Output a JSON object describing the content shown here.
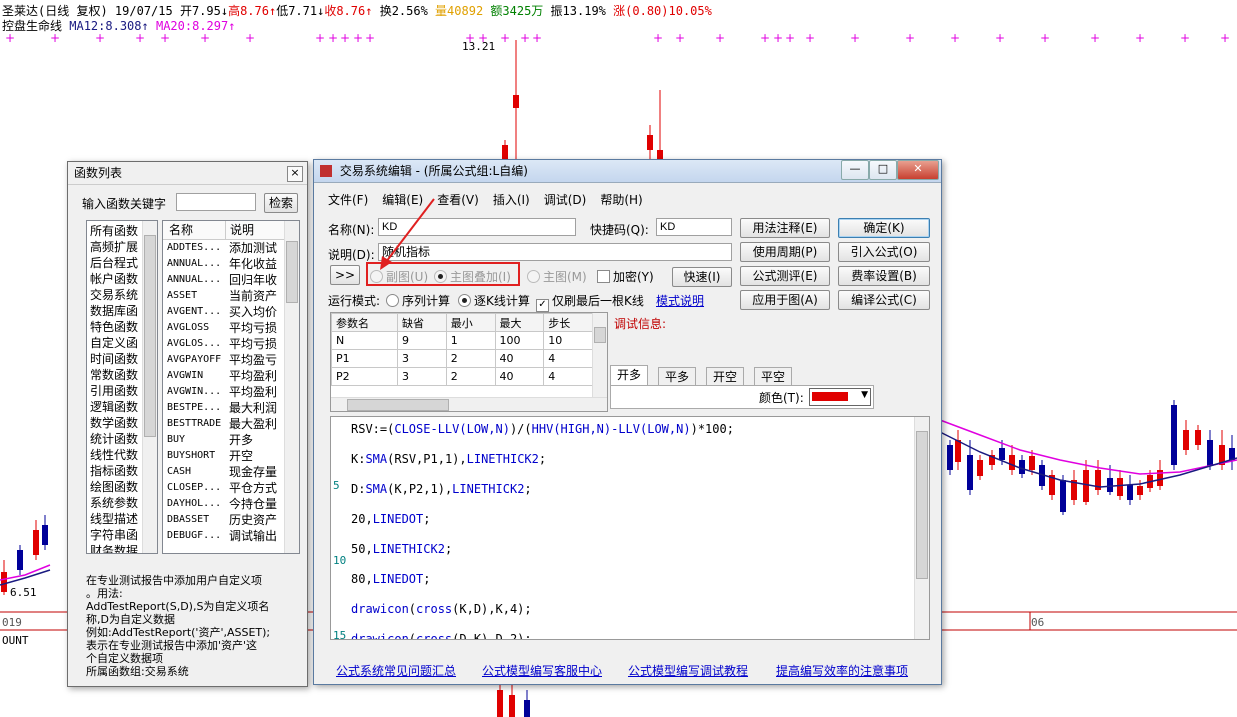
{
  "chart_header": {
    "stock": "圣莱达(日线 复权)",
    "date": "19/07/15",
    "open": "开7.95↓",
    "high": "高8.76↑",
    "low": "低7.71↓",
    "close": "收8.76↑",
    "turnover": "换2.56%",
    "volume": "量40892",
    "amount": "额3425万",
    "amplitude": "振13.19%",
    "change": "涨(0.80)10.05%"
  },
  "indicator_line": {
    "name": "控盘生命线",
    "ma12": "MA12:8.308↑",
    "ma20": "MA20:8.297↑"
  },
  "chart_labels": {
    "high_price": "13.21",
    "low_price": "6.51",
    "x_year": "019",
    "x_month": "06",
    "bottom_left": "OUNT"
  },
  "colors": {
    "up": "#e00000",
    "down": "#000099",
    "ma12": "#1a1a80",
    "ma20": "#e000e0",
    "marker": "#e000e0",
    "hilite": "#e02020"
  },
  "func_window": {
    "title": "函数列表",
    "close": "×",
    "search_label": "输入函数关键字",
    "search_value": "",
    "search_button": "检索",
    "categories": [
      "所有函数",
      "高频扩展",
      "后台程式",
      "帐户函数",
      "交易系统",
      "数据库函",
      "特色函数",
      "自定义函",
      "时间函数",
      "常数函数",
      "引用函数",
      "逻辑函数",
      "数学函数",
      "统计函数",
      "线性代数",
      "指标函数",
      "绘图函数",
      "系统参数",
      "线型描述",
      "字符串函",
      "财务数据"
    ],
    "col_name": "名称",
    "col_desc": "说明",
    "functions": [
      {
        "name": "ADDTES...",
        "desc": "添加测试"
      },
      {
        "name": "ANNUAL...",
        "desc": "年化收益"
      },
      {
        "name": "ANNUAL...",
        "desc": "回归年收"
      },
      {
        "name": "ASSET",
        "desc": "当前资产"
      },
      {
        "name": "AVGENT...",
        "desc": "买入均价"
      },
      {
        "name": "AVGLOSS",
        "desc": "平均亏损"
      },
      {
        "name": "AVGLOS...",
        "desc": "平均亏损"
      },
      {
        "name": "AVGPAYOFF",
        "desc": "平均盈亏"
      },
      {
        "name": "AVGWIN",
        "desc": "平均盈利"
      },
      {
        "name": "AVGWIN...",
        "desc": "平均盈利"
      },
      {
        "name": "BESTPE...",
        "desc": "最大利润"
      },
      {
        "name": "BESTTRADE",
        "desc": "最大盈利"
      },
      {
        "name": "BUY",
        "desc": "开多"
      },
      {
        "name": "BUYSHORT",
        "desc": "开空"
      },
      {
        "name": "CASH",
        "desc": "现金存量"
      },
      {
        "name": "CLOSEP...",
        "desc": "平仓方式"
      },
      {
        "name": "DAYHOL...",
        "desc": "今持仓量"
      },
      {
        "name": "DBASSET",
        "desc": "历史资产"
      },
      {
        "name": "DEBUGF...",
        "desc": "调试输出"
      }
    ],
    "help_lines": [
      "在专业测试报告中添加用户自定义项",
      "。用法:",
      "AddTestReport(S,D),S为自定义项名",
      "称,D为自定义数据",
      "例如:AddTestReport('资产',ASSET);",
      "表示在专业测试报告中添加'资产'这",
      "个自定义数据项",
      "所属函数组:交易系统"
    ]
  },
  "editor_window": {
    "title": "交易系统编辑 - (所属公式组:L自编)",
    "menu": [
      "文件(F)",
      "编辑(E)",
      "查看(V)",
      "插入(I)",
      "调试(D)",
      "帮助(H)"
    ],
    "name_label": "名称(N):",
    "name_value": "KD",
    "shortcut_label": "快捷码(Q):",
    "shortcut_value": "KD",
    "desc_label": "说明(D):",
    "desc_value": "随机指标",
    "expand_button": ">>",
    "radio_sub": "副图(U)",
    "radio_main_overlay": "主图叠加(I)",
    "radio_main": "主图(M)",
    "encrypt": "加密(Y)",
    "quick_button": "快速(I)",
    "run_mode_label": "运行模式:",
    "mode_sequence": "序列计算",
    "mode_bar": "逐K线计算",
    "only_last": "仅刷最后一根K线",
    "mode_help": "模式说明",
    "buttons_mid": [
      "用法注释(E)",
      "使用周期(P)",
      "公式测评(E)",
      "应用于图(A)"
    ],
    "buttons_right": [
      "确定(K)",
      "引入公式(O)",
      "费率设置(B)",
      "编译公式(C)"
    ],
    "param_headers": [
      "参数名",
      "缺省",
      "最小",
      "最大",
      "步长"
    ],
    "params": [
      [
        "N",
        "9",
        "1",
        "100",
        "10"
      ],
      [
        "P1",
        "3",
        "2",
        "40",
        "4"
      ],
      [
        "P2",
        "3",
        "2",
        "40",
        "4"
      ]
    ],
    "debug_label": "调试信息:",
    "tabs": [
      "开多",
      "平多",
      "开空",
      "平空"
    ],
    "color_label": "颜色(T):",
    "color_value": "#e00000",
    "code_lines": [
      [
        {
          "t": "RSV:=(",
          "c": "k"
        },
        {
          "t": "CLOSE-LLV(LOW,N)",
          "c": "b"
        },
        {
          "t": ")/(",
          "c": "k"
        },
        {
          "t": "HHV(HIGH,N)-LLV(LOW,N)",
          "c": "b"
        },
        {
          "t": ")*100;",
          "c": "k"
        }
      ],
      [
        {
          "t": "K:",
          "c": "k"
        },
        {
          "t": "SMA",
          "c": "b"
        },
        {
          "t": "(RSV,P1,1),",
          "c": "k"
        },
        {
          "t": "LINETHICK2",
          "c": "b"
        },
        {
          "t": ";",
          "c": "k"
        }
      ],
      [
        {
          "t": "D:",
          "c": "k"
        },
        {
          "t": "SMA",
          "c": "b"
        },
        {
          "t": "(K,P2,1),",
          "c": "k"
        },
        {
          "t": "LINETHICK2",
          "c": "b"
        },
        {
          "t": ";",
          "c": "k"
        }
      ],
      [
        {
          "t": "20,",
          "c": "k"
        },
        {
          "t": "LINEDOT",
          "c": "b"
        },
        {
          "t": ";",
          "c": "k"
        }
      ],
      [
        {
          "t": "50,",
          "c": "k"
        },
        {
          "t": "LINETHICK2",
          "c": "b"
        },
        {
          "t": ";",
          "c": "k"
        }
      ],
      [
        {
          "t": "80,",
          "c": "k"
        },
        {
          "t": "LINEDOT",
          "c": "b"
        },
        {
          "t": ";",
          "c": "k"
        }
      ],
      [
        {
          "t": "drawicon",
          "c": "b"
        },
        {
          "t": "(",
          "c": "k"
        },
        {
          "t": "cross",
          "c": "b"
        },
        {
          "t": "(K,D),K,4);",
          "c": "k"
        }
      ],
      [
        {
          "t": "drawicon",
          "c": "b"
        },
        {
          "t": "(",
          "c": "k"
        },
        {
          "t": "cross",
          "c": "b"
        },
        {
          "t": "(D,K),D,2);",
          "c": "k"
        }
      ]
    ],
    "line_numbers": [
      "5",
      "10",
      "15"
    ],
    "footer_links": [
      "公式系统常见问题汇总",
      "公式模型编写客服中心",
      "公式模型编写调试教程",
      "提高编写效率的注意事项"
    ]
  }
}
